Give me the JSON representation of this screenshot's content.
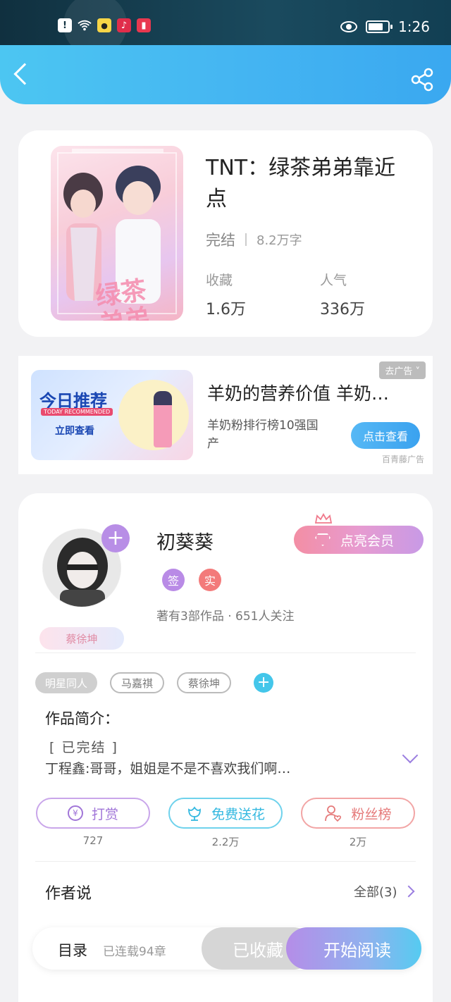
{
  "status_bar": {
    "time": "1:26",
    "left_icons": [
      "alert-icon",
      "wifi-icon",
      "chat-app-icon",
      "music-app-icon",
      "book-app-icon"
    ],
    "right_icons": [
      "eye-icon",
      "battery-icon"
    ]
  },
  "header": {
    "back_icon": "back-chevron-icon",
    "share_icon": "share-icon",
    "gradient": [
      "#4cc6f2",
      "#3aa8f0"
    ]
  },
  "book": {
    "title": "TNT：绿茶弟弟靠近点",
    "cover_text": "绿茶弟弟靠近点",
    "status": "完结",
    "words": "8.2万字",
    "stats": [
      {
        "label": "收藏",
        "value": "1.6万"
      },
      {
        "label": "人气",
        "value": "336万"
      }
    ]
  },
  "ad": {
    "badge": "去广告 ˅",
    "image_title": "今日推荐",
    "image_subtitle": "TODAY RECOMMENDED",
    "image_cta": "立即查看",
    "title": "羊奶的营养价值 羊奶…",
    "description": "羊奶粉排行榜10强国产",
    "button": "点击查看",
    "source": "百青藤广告"
  },
  "author": {
    "name": "初葵葵",
    "vip_button": "点亮会员",
    "badges": [
      "签",
      "实"
    ],
    "stats": "著有3部作品 · 651人关注",
    "fan_tag": "蔡徐坤",
    "tags": [
      "明星同人",
      "马嘉祺",
      "蔡徐坤"
    ]
  },
  "intro": {
    "title": "作品简介：",
    "status": "[ 已完结 ]",
    "text": "丁程鑫:哥哥，姐姐是不是不喜欢我们啊…"
  },
  "actions": [
    {
      "label": "打赏",
      "count": "727"
    },
    {
      "label": "免费送花",
      "count": "2.2万"
    },
    {
      "label": "粉丝榜",
      "count": "2万"
    }
  ],
  "author_says": {
    "title": "作者说",
    "all_label": "全部(3)"
  },
  "bottom_bar": {
    "toc": "目录",
    "chapters": "已连载94章",
    "collected": "已收藏",
    "read": "开始阅读"
  },
  "colors": {
    "accent_blue": "#45b6f2",
    "accent_purple": "#b58de8",
    "pink": "#f38ea4"
  }
}
